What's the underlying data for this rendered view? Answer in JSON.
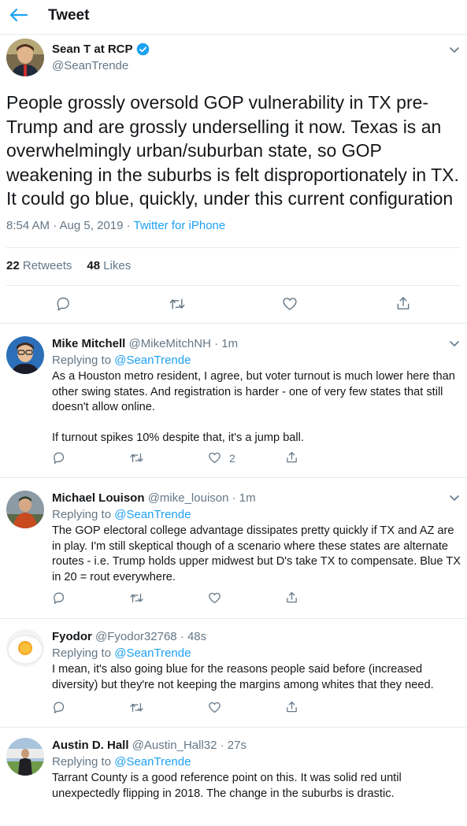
{
  "header": {
    "title": "Tweet"
  },
  "main_tweet": {
    "name": "Sean T at RCP",
    "handle": "@SeanTrende",
    "text": "People grossly oversold GOP vulnerability in TX pre-Trump and are grossly underselling it now. Texas is an overwhelmingly urban/suburban state, so GOP weakening in the suburbs is felt disproportionately in TX. It could go blue, quickly, under this current configuration",
    "timestamp": "8:54 AM · Aug 5, 2019 · ",
    "source": "Twitter for iPhone",
    "retweets_count": "22",
    "retweets_label": "Retweets",
    "likes_count": "48",
    "likes_label": "Likes"
  },
  "replies": [
    {
      "name": "Mike Mitchell",
      "handle_time": "@MikeMitchNH · 1m",
      "replying_label": "Replying to ",
      "replying_to": "@SeanTrende",
      "text": "As a Houston metro resident, I agree, but voter turnout is much lower here than other swing states. And registration is harder - one of very few states that still doesn't allow online.\n\nIf turnout spikes 10% despite that, it's a jump ball.",
      "like_count": "2"
    },
    {
      "name": "Michael Louison",
      "handle_time": "@mike_louison · 1m",
      "replying_label": "Replying to ",
      "replying_to": "@SeanTrende",
      "text": "The GOP electoral college advantage dissipates pretty quickly if TX and AZ are in play.  I'm still skeptical though of a scenario where these states are alternate routes - i.e. Trump holds upper midwest but D's take TX to compensate.  Blue TX in 20 = rout everywhere.",
      "like_count": ""
    },
    {
      "name": "Fyodor",
      "handle_time": "@Fyodor32768 · 48s",
      "replying_label": "Replying to ",
      "replying_to": "@SeanTrende",
      "text": "I mean, it's also going blue for the reasons people said before (increased diversity) but they're not keeping the margins among whites that they need.",
      "like_count": ""
    },
    {
      "name": "Austin D. Hall",
      "handle_time": "@Austin_Hall32 · 27s",
      "replying_label": "Replying to ",
      "replying_to": "@SeanTrende",
      "text": "Tarrant County is a good reference point on this. It was solid red until unexpectedly flipping in 2018. The change in the suburbs is drastic.",
      "like_count": ""
    }
  ],
  "icons": [
    "back-arrow-icon",
    "verified-badge-icon",
    "chevron-down-icon",
    "reply-icon",
    "retweet-icon",
    "like-icon",
    "share-icon"
  ],
  "colors": {
    "accent": "#1da1f2",
    "muted": "#657786",
    "text": "#14171a",
    "divider": "#e6ecf0"
  }
}
